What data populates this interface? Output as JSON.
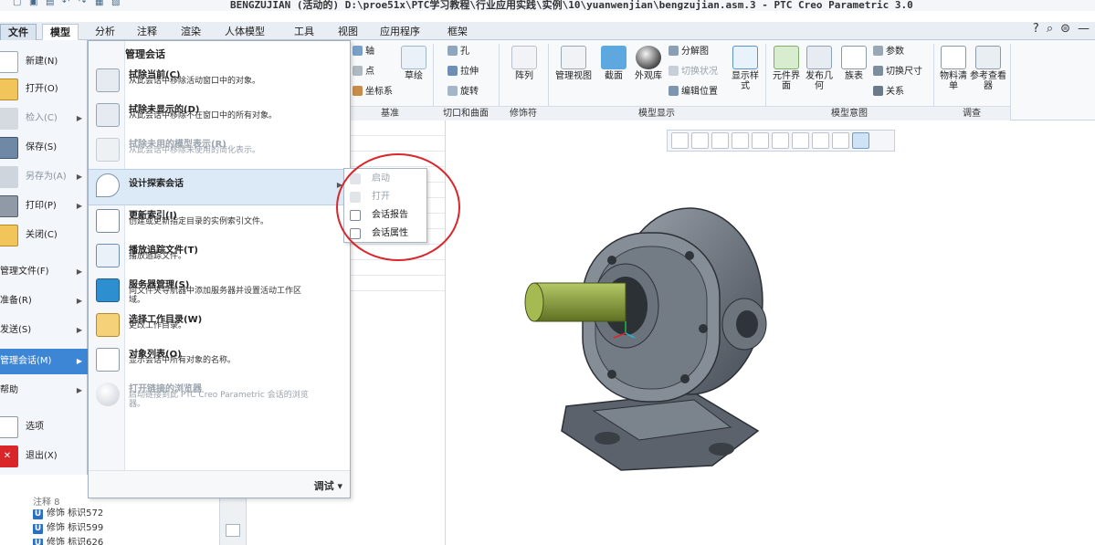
{
  "title_bar": {
    "title": "BENGZUJIAN (活动的) D:\\proe51x\\PTC学习教程\\行业应用实践\\实例\\10\\yuanwenjian\\bengzujian.asm.3 - PTC Creo Parametric 3.0"
  },
  "tabs": [
    {
      "label": "文件"
    },
    {
      "label": "模型"
    },
    {
      "label": "分析"
    },
    {
      "label": "注释"
    },
    {
      "label": "渲染"
    },
    {
      "label": "人体模型"
    },
    {
      "label": "工具"
    },
    {
      "label": "视图"
    },
    {
      "label": "应用程序"
    },
    {
      "label": "框架"
    }
  ],
  "file_tab_arrow": "▾",
  "ribbon": {
    "datum": {
      "axis": "轴",
      "point": "点",
      "csys": "坐标系",
      "sketch": "草绘",
      "group": "基准"
    },
    "cut": {
      "hole": "孔",
      "extrude": "拉伸",
      "revolve": "旋转",
      "group": "切口和曲面"
    },
    "modifier": {
      "pattern": "阵列",
      "group": "修饰符"
    },
    "display": {
      "manage_view": "管理视图",
      "section": "截面",
      "appearance": "外观库",
      "explode": "分解图",
      "toggle_state": "切换状况",
      "edit_position": "编辑位置",
      "display_style": "显示样式",
      "group": "模型显示"
    },
    "intent": {
      "component_interface": "元件界面",
      "publish_geom": "发布几何",
      "family_table": "族表",
      "params": "参数",
      "switch_dim": "切换尺寸",
      "relations": "关系",
      "group": "模型意图"
    },
    "investigate": {
      "bom": "物料清单",
      "ref_viewer": "参考查看器",
      "group": "调查"
    }
  },
  "file_menu": {
    "items": [
      {
        "label": "新建(N)",
        "disabled": false,
        "arrow": false
      },
      {
        "label": "打开(O)",
        "disabled": false,
        "arrow": false
      },
      {
        "label": "检入(C)",
        "disabled": true,
        "arrow": true
      },
      {
        "label": "保存(S)",
        "disabled": false,
        "arrow": false
      },
      {
        "label": "另存为(A)",
        "disabled": true,
        "arrow": true
      },
      {
        "label": "打印(P)",
        "disabled": false,
        "arrow": true
      },
      {
        "label": "关闭(C)",
        "disabled": false,
        "arrow": false
      },
      {
        "label": "管理文件(F)",
        "disabled": false,
        "arrow": true
      },
      {
        "label": "准备(R)",
        "disabled": false,
        "arrow": true
      },
      {
        "label": "发送(S)",
        "disabled": false,
        "arrow": true
      },
      {
        "label": "管理会话(M)",
        "disabled": false,
        "arrow": true,
        "selected": true
      },
      {
        "label": "帮助",
        "disabled": false,
        "arrow": true
      },
      {
        "label": "选项",
        "disabled": false,
        "arrow": false
      },
      {
        "label": "退出(X)",
        "disabled": false,
        "arrow": false
      }
    ]
  },
  "session_menu": {
    "header": "管理会话",
    "items": [
      {
        "title": "拭除当前(C)",
        "desc": "从此会话中移除活动窗口中的对象。",
        "disabled": false
      },
      {
        "title": "拭除未显示的(D)",
        "desc": "从此会话中移除不在窗口中的所有对象。",
        "disabled": false
      },
      {
        "title": "拭除未用的模型表示(R)",
        "desc": "从此会话中移除未使用的简化表示。",
        "disabled": true
      },
      {
        "title": "设计探索会话",
        "desc": "",
        "disabled": false,
        "highlight": true,
        "arrow": true
      },
      {
        "title": "更新索引(I)",
        "desc": "创建或更新指定目录的实例索引文件。",
        "disabled": false
      },
      {
        "title": "播放追踪文件(T)",
        "desc": "播放追踪文件。",
        "disabled": false
      },
      {
        "title": "服务器管理(S)",
        "desc": "向文件夹导航器中添加服务器并设置活动工作区域。",
        "disabled": false
      },
      {
        "title": "选择工作目录(W)",
        "desc": "更改工作目录。",
        "disabled": false
      },
      {
        "title": "对象列表(O)",
        "desc": "显示会话中所有对象的名称。",
        "disabled": false
      },
      {
        "title": "打开链接的浏览器",
        "desc": "启动链接到此 PTC Creo Parametric 会话的浏览器。",
        "disabled": true
      }
    ],
    "footer": "调试 ▾"
  },
  "flyout": {
    "items": [
      {
        "label": "启动",
        "disabled": true
      },
      {
        "label": "打开",
        "disabled": true
      },
      {
        "label": "会话报告",
        "disabled": false
      },
      {
        "label": "会话属性",
        "disabled": false
      }
    ]
  },
  "tree": [
    {
      "label": "修饰 标识572"
    },
    {
      "label": "修饰 标识599"
    },
    {
      "label": "修饰 标识626"
    }
  ],
  "tree_partial": "注释 8",
  "colors": {
    "accent": "#3d86d6",
    "annotation": "#d9262b",
    "shaft": "#8fa63a",
    "body": "#6e7680"
  }
}
